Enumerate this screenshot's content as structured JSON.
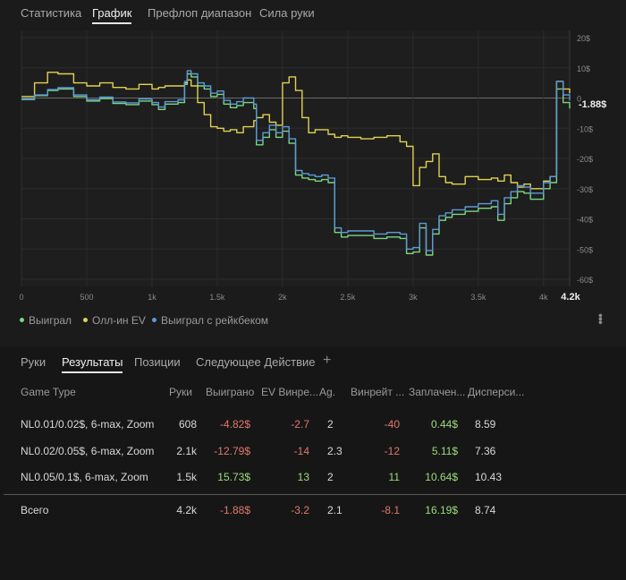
{
  "top_tabs": [
    "Статистика",
    "График",
    "Префлоп диапазон",
    "Сила руки"
  ],
  "active_top_tab": "График",
  "chart_data": {
    "type": "line",
    "x_ticks": [
      "0",
      "500",
      "1k",
      "1.5k",
      "2k",
      "2.5k",
      "3k",
      "3.5k",
      "4k"
    ],
    "x_end_label": "4.2k",
    "y_ticks": [
      "20$",
      "10$",
      "0",
      "-10$",
      "-20$",
      "-30$",
      "-40$",
      "-50$",
      "-60$"
    ],
    "current_value_label": "-1.88$",
    "xlim": [
      0,
      4200
    ],
    "ylim": [
      -60,
      20
    ],
    "grid": true,
    "series": [
      {
        "name": "Выиграл",
        "color": "#7ad67f",
        "x": [
          0,
          100,
          200,
          280,
          400,
          500,
          600,
          700,
          800,
          900,
          1000,
          1050,
          1100,
          1200,
          1250,
          1270,
          1300,
          1350,
          1400,
          1450,
          1500,
          1550,
          1600,
          1650,
          1700,
          1780,
          1800,
          1850,
          1900,
          1950,
          2000,
          2050,
          2100,
          2150,
          2200,
          2250,
          2300,
          2350,
          2400,
          2450,
          2500,
          2600,
          2700,
          2800,
          2900,
          2950,
          3000,
          3050,
          3100,
          3150,
          3200,
          3250,
          3300,
          3400,
          3500,
          3600,
          3650,
          3700,
          3750,
          3800,
          3850,
          3900,
          4000,
          4050,
          4100,
          4150,
          4200
        ],
        "y": [
          -0.5,
          0.8,
          2.5,
          3.0,
          0.5,
          -1.0,
          -0.2,
          -1.8,
          -2.2,
          -1.0,
          -2.2,
          -3.8,
          -2.0,
          -1.5,
          4.5,
          8.0,
          7.0,
          4.0,
          3.0,
          0.5,
          1.2,
          -2.0,
          -3.2,
          -2.5,
          -1.5,
          -3.5,
          -15.5,
          -13.0,
          -10.5,
          -13.0,
          -11.0,
          -15.0,
          -25.5,
          -26.5,
          -27.0,
          -27.5,
          -27.0,
          -28.0,
          -44.5,
          -46.0,
          -45.5,
          -45.5,
          -46.5,
          -46.0,
          -46.5,
          -51.5,
          -51.0,
          -43.0,
          -52.0,
          -45.0,
          -40.5,
          -39.5,
          -38.5,
          -37.5,
          -36.5,
          -36.0,
          -40.5,
          -35.0,
          -33.0,
          -31.0,
          -31.5,
          -33.5,
          -30.0,
          -28.0,
          3.0,
          -1.5,
          -3.5
        ]
      },
      {
        "name": "Олл-ин EV",
        "color": "#e0d251",
        "x": [
          0,
          100,
          200,
          280,
          400,
          500,
          600,
          700,
          800,
          900,
          1000,
          1050,
          1100,
          1200,
          1250,
          1270,
          1300,
          1350,
          1400,
          1450,
          1500,
          1550,
          1600,
          1650,
          1700,
          1780,
          1800,
          1850,
          1900,
          1950,
          2000,
          2050,
          2100,
          2150,
          2200,
          2250,
          2300,
          2350,
          2400,
          2450,
          2500,
          2600,
          2700,
          2800,
          2900,
          2950,
          3000,
          3050,
          3100,
          3150,
          3200,
          3250,
          3300,
          3400,
          3500,
          3600,
          3650,
          3700,
          3750,
          3800,
          3850,
          3900,
          4000,
          4050,
          4100,
          4150,
          4200
        ],
        "y": [
          0.5,
          5.0,
          8.5,
          8.0,
          5.0,
          4.0,
          5.0,
          3.5,
          3.0,
          4.5,
          3.0,
          3.5,
          4.0,
          4.0,
          5.0,
          6.0,
          4.0,
          -1.5,
          -5.5,
          -9.5,
          -10.0,
          -11.0,
          -10.5,
          -11.5,
          -9.5,
          -7.5,
          -6.5,
          -5.5,
          -8.0,
          -9.0,
          5.0,
          7.0,
          2.5,
          -6.5,
          -11.5,
          -10.5,
          -10.5,
          -12.0,
          -13.0,
          -12.5,
          -13.0,
          -13.5,
          -13.0,
          -12.5,
          -14.5,
          -16.0,
          -29.0,
          -23.0,
          -21.0,
          -18.5,
          -26.0,
          -28.0,
          -28.5,
          -26.0,
          -27.0,
          -26.5,
          -27.5,
          -25.5,
          -28.0,
          -29.5,
          -28.5,
          -30.0,
          -27.5,
          -26.0,
          5.5,
          3.0,
          1.5
        ]
      },
      {
        "name": "Выиграл с рейкбеком",
        "color": "#5d9ad8",
        "x": [
          0,
          100,
          200,
          280,
          400,
          500,
          600,
          700,
          800,
          900,
          1000,
          1050,
          1100,
          1200,
          1250,
          1270,
          1300,
          1350,
          1400,
          1450,
          1500,
          1550,
          1600,
          1650,
          1700,
          1780,
          1800,
          1850,
          1900,
          1950,
          2000,
          2050,
          2100,
          2150,
          2200,
          2250,
          2300,
          2350,
          2400,
          2450,
          2500,
          2600,
          2700,
          2800,
          2900,
          2950,
          3000,
          3050,
          3100,
          3150,
          3200,
          3250,
          3300,
          3400,
          3500,
          3600,
          3650,
          3700,
          3750,
          3800,
          3850,
          3900,
          4000,
          4050,
          4100,
          4150,
          4200
        ],
        "y": [
          -0.3,
          1.0,
          2.8,
          3.4,
          1.0,
          -0.6,
          0.3,
          -1.3,
          -1.6,
          -0.3,
          -1.5,
          -3.0,
          -1.2,
          -0.6,
          5.5,
          9.0,
          8.0,
          5.0,
          4.0,
          1.6,
          2.3,
          -0.8,
          -2.0,
          -1.2,
          0.0,
          -2.0,
          -14.0,
          -11.5,
          -9.0,
          -11.5,
          -9.5,
          -13.5,
          -24.0,
          -25.0,
          -25.5,
          -26.0,
          -25.5,
          -26.5,
          -43.0,
          -44.5,
          -44.0,
          -44.0,
          -45.0,
          -44.5,
          -45.0,
          -50.0,
          -49.5,
          -41.5,
          -50.5,
          -43.5,
          -39.0,
          -38.0,
          -37.0,
          -36.0,
          -35.0,
          -34.0,
          -38.5,
          -33.0,
          -31.0,
          -29.0,
          -29.5,
          -31.5,
          -28.0,
          -26.0,
          5.5,
          1.0,
          -0.8
        ]
      }
    ]
  },
  "legend": [
    {
      "label": "Выиграл",
      "color": "#7ad67f"
    },
    {
      "label": "Олл-ин EV",
      "color": "#e0d251"
    },
    {
      "label": "Выиграл с рейкбеком",
      "color": "#5d9ad8"
    }
  ],
  "sub_tabs": [
    "Руки",
    "Результаты",
    "Позиции",
    "Следующее Действие"
  ],
  "active_sub_tab": "Результаты",
  "add_tab_icon": "+",
  "table": {
    "columns": [
      "Game Type",
      "Руки",
      "Выиграно",
      "EV Винре...",
      "Ag.",
      "Винрейт ...",
      "Заплачен...",
      "Дисперси..."
    ],
    "rows": [
      {
        "game_type": "NL0.01/0.02$, 6-max, Zoom",
        "hands": "608",
        "won": "-4.82$",
        "ev_winrate": "-2.7",
        "ag": "2",
        "winrate": "-40",
        "paid": "0.44$",
        "variance": "8.59"
      },
      {
        "game_type": "NL0.02/0.05$, 6-max, Zoom",
        "hands": "2.1k",
        "won": "-12.79$",
        "ev_winrate": "-14",
        "ag": "2.3",
        "winrate": "-12",
        "paid": "5.11$",
        "variance": "7.36"
      },
      {
        "game_type": "NL0.05/0.1$, 6-max, Zoom",
        "hands": "1.5k",
        "won": "15.73$",
        "ev_winrate": "13",
        "ag": "2",
        "winrate": "11",
        "paid": "10.64$",
        "variance": "10.43"
      }
    ],
    "total": {
      "game_type": "Всего",
      "hands": "4.2k",
      "won": "-1.88$",
      "ev_winrate": "-3.2",
      "ag": "2.1",
      "winrate": "-8.1",
      "paid": "16.19$",
      "variance": "8.74"
    }
  },
  "colors": {
    "negative": "#e0786b",
    "positive": "#9bdc7a",
    "background": "#1b1b1b"
  }
}
